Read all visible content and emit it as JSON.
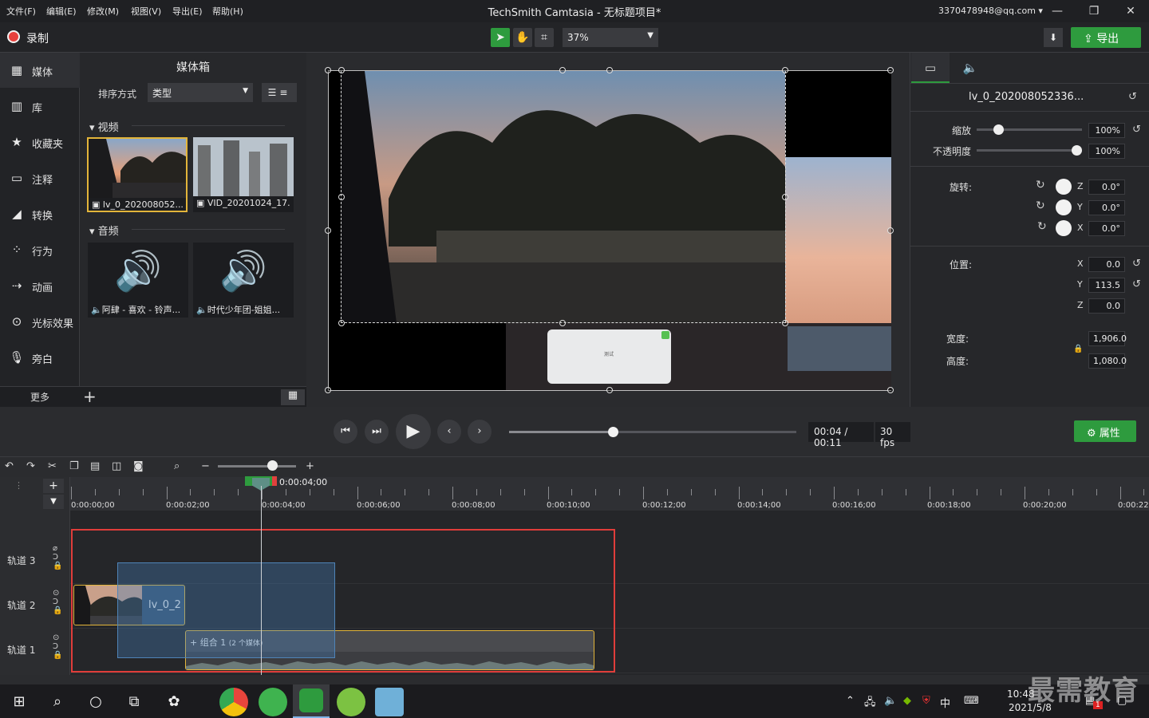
{
  "menu": [
    "文件(F)",
    "编辑(E)",
    "修改(M)",
    "视图(V)",
    "导出(E)",
    "帮助(H)"
  ],
  "app_title": "TechSmith Camtasia - 无标题项目*",
  "account": "3370478948@qq.com ▾",
  "record_label": "录制",
  "zoom_value": "37%",
  "export_label": "导出",
  "nav": [
    "媒体",
    "库",
    "收藏夹",
    "注释",
    "转换",
    "行为",
    "动画",
    "光标效果",
    "旁白"
  ],
  "more_label": "更多",
  "bin": {
    "title": "媒体箱",
    "sort_label": "排序方式",
    "sort_value": "类型",
    "video_section": "视频",
    "audio_section": "音频",
    "videos": [
      "lv_0_202008052...",
      "VID_20201024_17..."
    ],
    "audios": [
      "阿肆 - 喜欢 - 铃声...",
      "时代少年团-姐姐..."
    ]
  },
  "canvas_dialog_title": "测试",
  "props": {
    "clip_name": "lv_0_202008052336...",
    "scale_label": "缩放",
    "scale_value": "100%",
    "opacity_label": "不透明度",
    "opacity_value": "100%",
    "scale_level": 0.18,
    "opacity_level": 1.0,
    "rotation_label": "旋转:",
    "rot_z": "0.0°",
    "rot_y": "0.0°",
    "rot_x": "0.0°",
    "position_label": "位置:",
    "pos_x": "0.0",
    "pos_y": "113.5",
    "pos_z": "0.0",
    "width_label": "宽度:",
    "width_value": "1,906.0",
    "height_label": "高度:",
    "height_value": "1,080.0",
    "axis_x": "X",
    "axis_y": "Y",
    "axis_z": "Z"
  },
  "playback": {
    "time": "00:04 / 00:11",
    "fps": "30 fps",
    "progress": 0.36,
    "properties_label": "属性"
  },
  "timeline": {
    "playhead_time": "0:00:04;00",
    "ticks": [
      "0:00:00;00",
      "0:00:02;00",
      "0:00:04;00",
      "0:00:06;00",
      "0:00:08;00",
      "0:00:10;00",
      "0:00:12;00",
      "0:00:14;00",
      "0:00:16;00",
      "0:00:18;00",
      "0:00:20;00",
      "0:00:22"
    ],
    "tracks": [
      "轨道 3",
      "轨道 2",
      "轨道 1"
    ],
    "clip_video_label": "lv_0_2",
    "group_label": "组合 1",
    "group_sub": "(2 个媒体)"
  },
  "taskbar": {
    "time": "10:48",
    "date": "2021/5/8",
    "ime": "中",
    "watermark": "最需教育",
    "notify_count": "1"
  },
  "colors": {
    "accent_green": "#2e9b3e",
    "record_red": "#e8413d",
    "highlight_box": "#e03d3a",
    "selection_gold": "#e3b53a"
  }
}
